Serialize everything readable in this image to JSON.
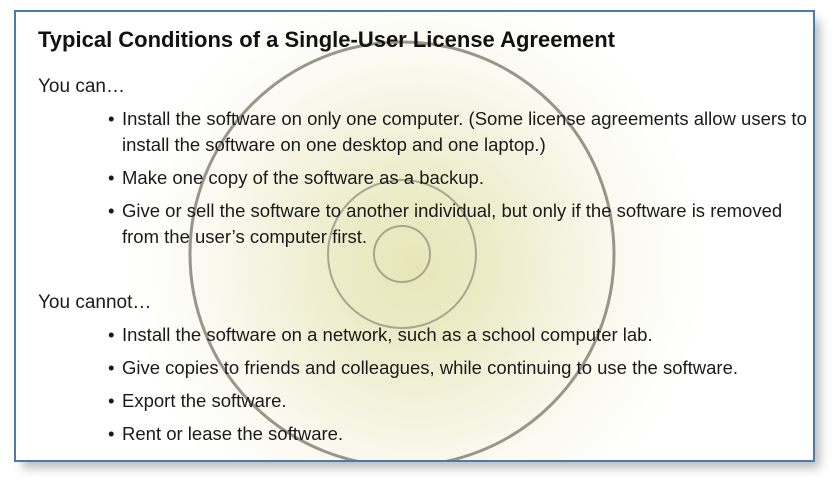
{
  "title": "Typical Conditions of a Single-User License Agreement",
  "can": {
    "heading": "You can…",
    "items": [
      "Install the software on only one computer. (Some license agreements allow users to install the software on one desktop and one laptop.)",
      "Make one copy of the software as a backup.",
      "Give or sell the software to another individual, but only if the software is removed from the user’s computer first."
    ]
  },
  "cannot": {
    "heading": "You cannot…",
    "items": [
      "Install the software on a network, such as a school computer lab.",
      "Give copies to friends and colleagues, while continuing to use the software.",
      "Export the software.",
      "Rent or lease the software."
    ]
  },
  "colors": {
    "border": "#4f79a6",
    "disc_glow": "#e8e6b8"
  },
  "icons": [
    "cd-disc-icon"
  ]
}
